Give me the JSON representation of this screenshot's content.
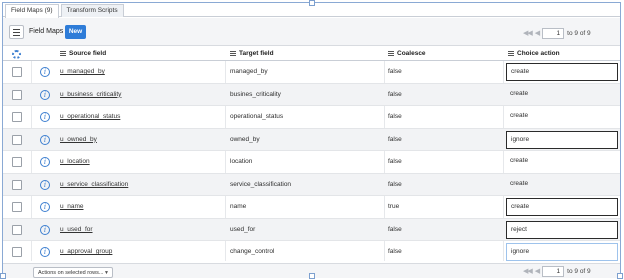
{
  "tabs": [
    {
      "label": "Field Maps (9)"
    },
    {
      "label": "Transform Scripts"
    }
  ],
  "header": {
    "title": "Field Maps",
    "new_label": "New"
  },
  "pager_top": {
    "first": "◀◀",
    "prev": "◀",
    "page": "1",
    "range": "to 9 of 9",
    "next": "▶",
    "last": "▶▶"
  },
  "columns": {
    "source": "Source field",
    "target": "Target field",
    "coalesce": "Coalesce",
    "choice": "Choice action"
  },
  "rows": [
    {
      "source": "u_managed_by",
      "target": "managed_by",
      "coalesce": "false",
      "choice": "create"
    },
    {
      "source": "u_business_criticality",
      "target": "busines_criticality",
      "coalesce": "false",
      "choice": "create"
    },
    {
      "source": "u_operational_status",
      "target": "operational_status",
      "coalesce": "false",
      "choice": "create"
    },
    {
      "source": "u_owned_by",
      "target": "owned_by",
      "coalesce": "false",
      "choice": "ignore"
    },
    {
      "source": "u_location",
      "target": "location",
      "coalesce": "false",
      "choice": "create"
    },
    {
      "source": "u_service_classification",
      "target": "service_classification",
      "coalesce": "false",
      "choice": "create"
    },
    {
      "source": "u_name",
      "target": "name",
      "coalesce": "true",
      "choice": "create"
    },
    {
      "source": "u_used_for",
      "target": "used_for",
      "coalesce": "false",
      "choice": "reject"
    },
    {
      "source": "u_approval_group",
      "target": "change_control",
      "coalesce": "false",
      "choice": "ignore"
    }
  ],
  "footer": {
    "actions_placeholder": "Actions on selected rows...",
    "page": "1",
    "range": "to 9 of 9"
  },
  "colors": {
    "accent": "#2e7cd8",
    "frame": "#8aa9d4"
  }
}
